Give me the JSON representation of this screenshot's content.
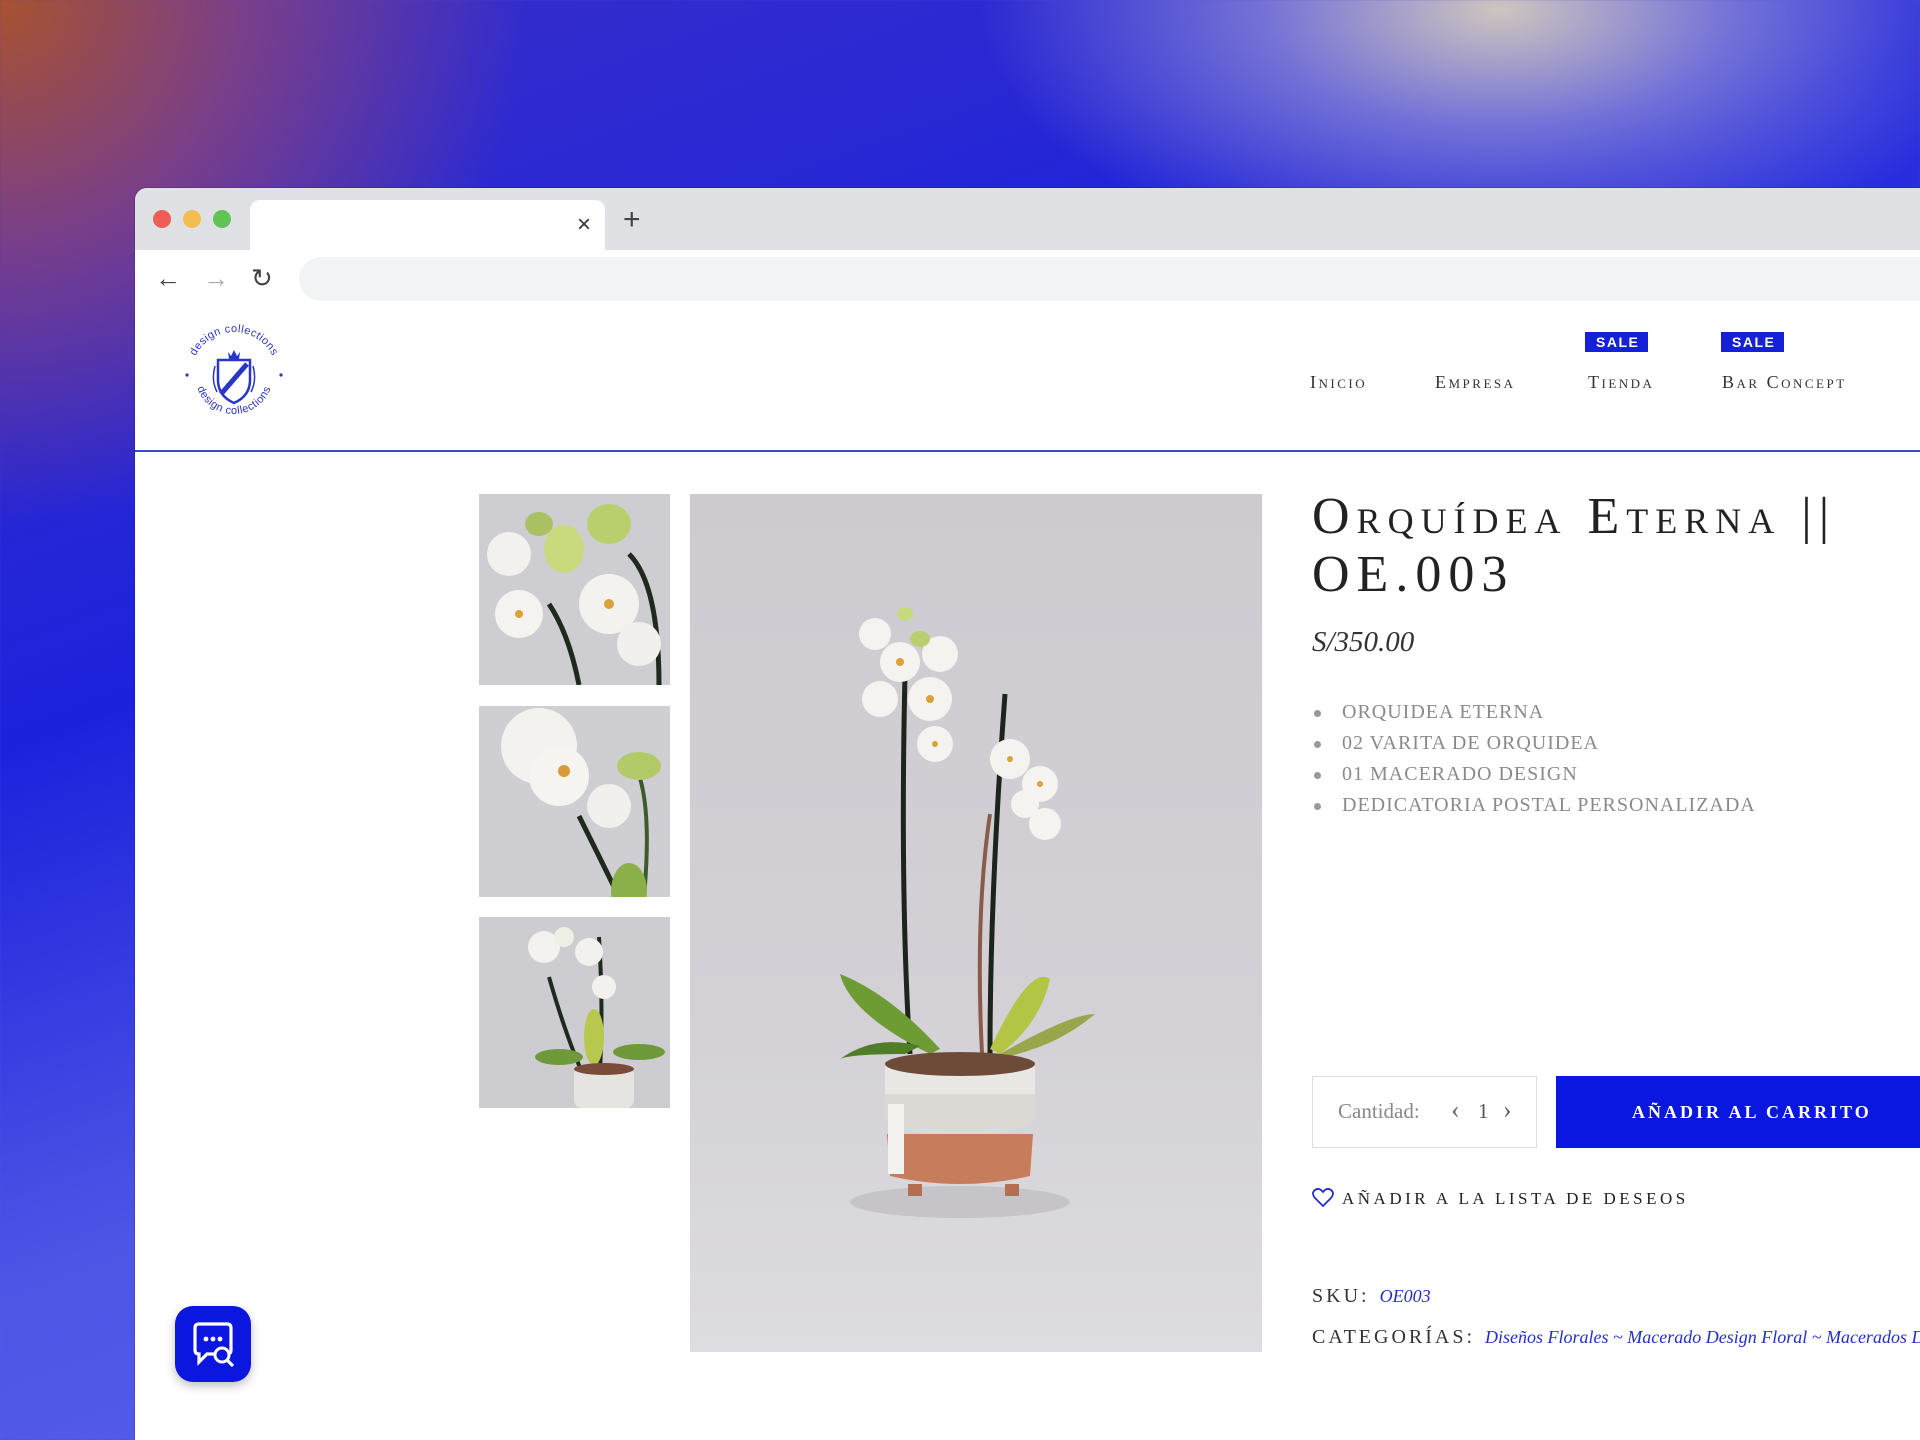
{
  "browser": {
    "tab_close": "×",
    "new_tab": "+",
    "back": "←",
    "forward": "→",
    "reload": "↻"
  },
  "header": {
    "logo_text": "design collections",
    "nav": [
      {
        "label": "Inicio",
        "badge": ""
      },
      {
        "label": "Empresa",
        "badge": ""
      },
      {
        "label": "Tienda",
        "badge": "SALE"
      },
      {
        "label": "Bar Concept",
        "badge": "SALE"
      }
    ]
  },
  "product": {
    "title_line1": "Orquídea Eterna ||",
    "title_line2": "OE.003",
    "price": "S/350.00",
    "features": [
      "ORQUIDEA ETERNA",
      "02 VARITA DE ORQUIDEA",
      "01 MACERADO DESIGN",
      "DEDICATORIA POSTAL PERSONALIZADA"
    ],
    "quantity_label": "Cantidad:",
    "quantity_value": "1",
    "qty_decrease": "‹",
    "qty_increase": "›",
    "add_to_cart": "AÑADIR AL CARRITO",
    "wishlist": "AÑADIR A LA LISTA DE DESEOS",
    "sku_label": "SKU:",
    "sku_value": "OE003",
    "categories_label": "CATEGORÍAS:",
    "categories_value": "Diseños Florales ~ Macerado Design Floral ~ Macerados Design"
  },
  "icons": {
    "heart": "heart-icon",
    "chat": "chat-search-icon"
  },
  "colors": {
    "brand_blue": "#0a17e0",
    "link_blue": "#2230c9",
    "sale_badge": "#1421d6"
  }
}
